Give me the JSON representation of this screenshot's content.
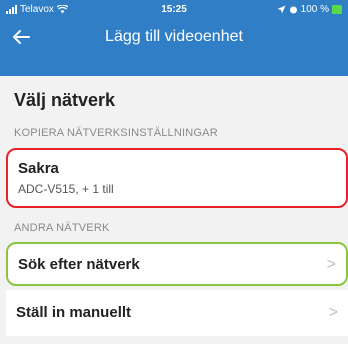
{
  "status_bar": {
    "carrier": "Telavox",
    "time": "15:25",
    "battery": "100 %"
  },
  "nav": {
    "back_icon": "arrow-left-icon",
    "title": "Lägg till videoenhet"
  },
  "page": {
    "section_title": "Välj nätverk",
    "copy_label": "KOPIERA NÄTVERKSINSTÄLLNINGAR",
    "copy_item": {
      "title": "Sakra",
      "subtitle": "ADC-V515, + 1 till"
    },
    "other_label": "ANDRA NÄTVERK",
    "other_items": [
      {
        "title": "Sök efter nätverk",
        "chevron": ">"
      },
      {
        "title": "Ställ in manuellt",
        "chevron": ">"
      }
    ]
  },
  "colors": {
    "header": "#2f7ec6",
    "highlight_red": "#e8202a",
    "highlight_green": "#8cc63f"
  }
}
